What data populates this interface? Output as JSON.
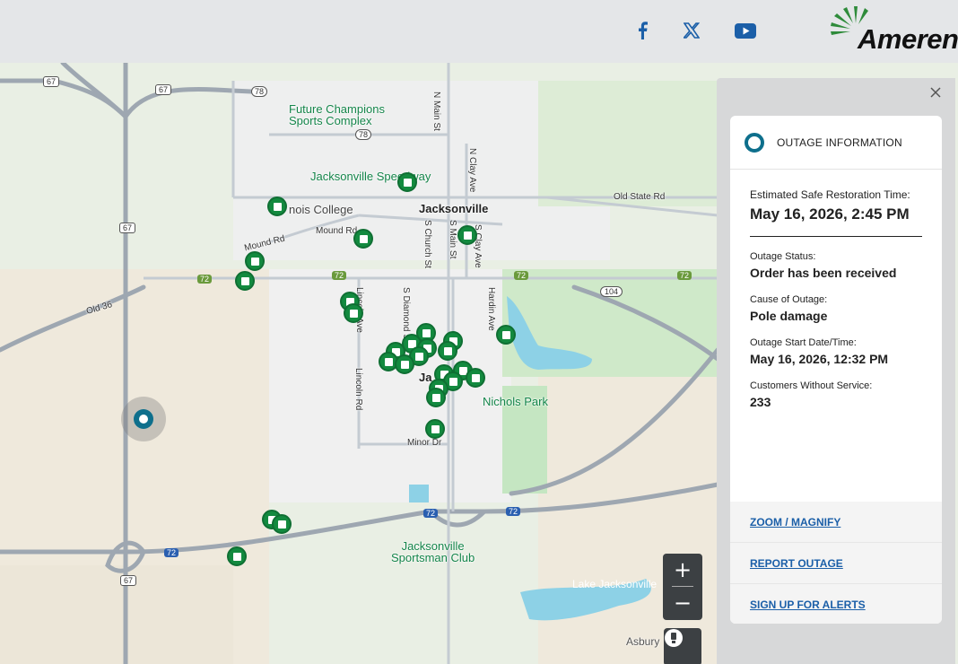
{
  "header": {
    "social": [
      "facebook-icon",
      "x-icon",
      "youtube-icon"
    ],
    "logo_text": "Ameren"
  },
  "map": {
    "pois": {
      "future_champions_1": "Future Champions",
      "future_champions_2": "Sports Complex",
      "speedway": "Jacksonville Speedway",
      "college": "nois College",
      "nichols_park": "Nichols Park",
      "sportsman_1": "Jacksonville",
      "sportsman_2": "Sportsman Club"
    },
    "city": "Jacksonville",
    "area_labels": {
      "lake": "Lake Jacksonville",
      "asbury": "Asbury"
    },
    "road_labels": {
      "n_main": "N Main St",
      "n_clay": "N Clay Ave",
      "old_state": "Old State Rd",
      "mound_rd_1": "Mound Rd",
      "mound_rd_2": "Mound Rd",
      "s_church": "S Church St",
      "s_main": "S Main St",
      "s_clay": "S Clay Ave",
      "old_36": "Old 36",
      "lincoln_ave": "Lincoln Ave",
      "s_diamond": "S Diamond St",
      "hardin": "Hardin Ave",
      "lincoln_rd": "Lincoln Rd",
      "minor_dr": "Minor Dr",
      "ja": "Ja"
    },
    "shields": {
      "s67a": "67",
      "s67b": "67",
      "s78": "78",
      "s78b": "78",
      "s67c": "67",
      "s72a": "72",
      "s72b": "72",
      "s72c": "72",
      "s72d": "72",
      "s104": "104",
      "s72e": "72",
      "s72f": "72",
      "s72g": "72",
      "s67d": "67"
    },
    "zoom_in": "+",
    "zoom_out": "−"
  },
  "panel": {
    "title": "OUTAGE INFORMATION",
    "restoration_label": "Estimated Safe Restoration Time:",
    "restoration_value": "May 16, 2026, 2:45 PM",
    "status_label": "Outage Status:",
    "status_value": "Order has been received",
    "cause_label": "Cause of Outage:",
    "cause_value": "Pole damage",
    "start_label": "Outage Start Date/Time:",
    "start_value": "May 16, 2026, 12:32 PM",
    "customers_label": "Customers Without Service:",
    "customers_value": "233",
    "links": {
      "zoom": "ZOOM / MAGNIFY",
      "report": "REPORT OUTAGE",
      "alerts": "SIGN UP FOR ALERTS"
    }
  },
  "colors": {
    "outage_marker": "#138a3f",
    "selected_marker": "#0e6f8c",
    "link": "#1b5fa8"
  }
}
